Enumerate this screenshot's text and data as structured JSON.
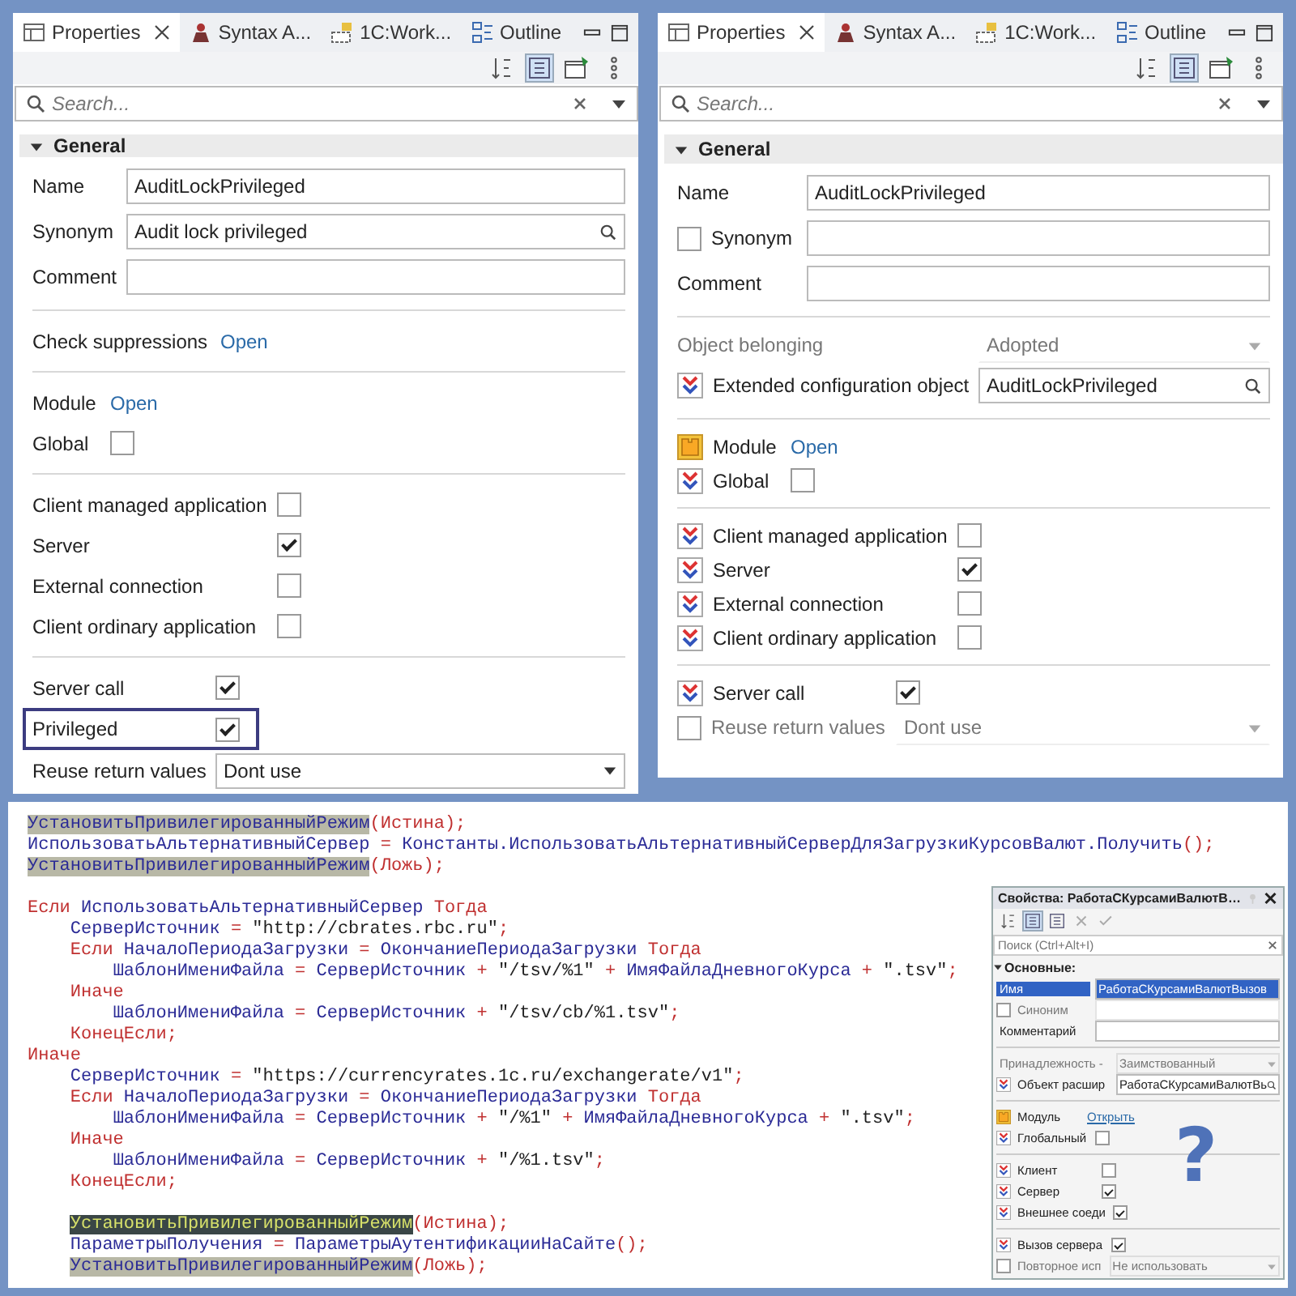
{
  "panels": [
    {
      "tabs": [
        {
          "label": "Properties",
          "kind": "table",
          "selected": true
        },
        {
          "label": "Syntax A...",
          "kind": "figure",
          "selected": false
        },
        {
          "label": "1C:Work...",
          "kind": "blocks",
          "selected": false
        },
        {
          "label": "Outline",
          "kind": "outline",
          "selected": false
        }
      ],
      "toolbar": [
        {
          "kind": "sort",
          "selected": false
        },
        {
          "kind": "tree",
          "selected": true
        },
        {
          "kind": "new-window",
          "selected": false
        },
        {
          "kind": "more",
          "selected": false
        }
      ],
      "search": {
        "placeholder": "Search..."
      },
      "section": {
        "title": "General",
        "expanded": true
      },
      "groups": [
        [
          {
            "kind": "field",
            "label": "Name",
            "value": "AuditLockPrivileged"
          },
          {
            "kind": "search-field",
            "label": "Synonym",
            "value": "Audit lock privileged"
          },
          {
            "kind": "field",
            "label": "Comment"
          }
        ],
        [
          {
            "kind": "link",
            "label": "Check suppressions",
            "link": "Open"
          }
        ],
        [
          {
            "kind": "link",
            "label": "Module",
            "link": "Open"
          },
          {
            "kind": "check",
            "label": "Global",
            "checked": false
          }
        ],
        [
          {
            "kind": "check",
            "label": "Client managed application",
            "checked": false
          },
          {
            "kind": "check",
            "label": "Server",
            "checked": true
          },
          {
            "kind": "check",
            "label": "External connection",
            "checked": false
          },
          {
            "kind": "check",
            "label": "Client ordinary application",
            "checked": false
          }
        ],
        [
          {
            "kind": "check",
            "label": "Server call",
            "checked": true,
            "outlined": false
          },
          {
            "kind": "check",
            "label": "Privileged",
            "checked": true,
            "outlined": true
          },
          {
            "kind": "select",
            "label": "Reuse return values",
            "value": "Dont use",
            "outlined": false
          }
        ]
      ]
    },
    {
      "tabs": [
        {
          "label": "Properties",
          "kind": "table",
          "selected": true
        },
        {
          "label": "Syntax A...",
          "kind": "figure",
          "selected": false
        },
        {
          "label": "1C:Work...",
          "kind": "blocks",
          "selected": false
        },
        {
          "label": "Outline",
          "kind": "outline",
          "selected": false
        }
      ],
      "toolbar": [
        {
          "kind": "sort",
          "selected": false
        },
        {
          "kind": "tree",
          "selected": true
        },
        {
          "kind": "new-window",
          "selected": false
        },
        {
          "kind": "more",
          "selected": false
        }
      ],
      "search": {
        "placeholder": "Search..."
      },
      "section": {
        "title": "General",
        "expanded": true
      },
      "groups": [
        [
          {
            "kind": "field",
            "label": "Name",
            "value": "AuditLockPrivileged"
          },
          {
            "kind": "field",
            "label": "Synonym",
            "adopted": false
          },
          {
            "kind": "field",
            "label": "Comment"
          }
        ],
        [
          {
            "kind": "select",
            "label": "Object belonging",
            "value": "Adopted",
            "disabled": true
          },
          {
            "kind": "search-field",
            "label": "Extended configuration object",
            "value": "AuditLockPrivileged",
            "adopted": true
          }
        ],
        [
          {
            "kind": "module-link",
            "label": "Module",
            "link": "Open"
          },
          {
            "kind": "check",
            "label": "Global",
            "checked": false,
            "adopted": true
          }
        ],
        [
          {
            "kind": "check",
            "label": "Client managed application",
            "checked": false,
            "adopted": true
          },
          {
            "kind": "check",
            "label": "Server",
            "checked": true,
            "adopted": true
          },
          {
            "kind": "check",
            "label": "External connection",
            "checked": false,
            "adopted": true
          },
          {
            "kind": "check",
            "label": "Client ordinary application",
            "checked": false,
            "adopted": true
          }
        ],
        [
          {
            "kind": "check",
            "label": "Server call",
            "checked": true,
            "adopted": true
          },
          {
            "kind": "select",
            "label": "Reuse return values",
            "value": "Dont use",
            "adopted": false,
            "disabled": true
          }
        ]
      ]
    }
  ],
  "code": {
    "blocks": [
      [
        [
          {
            "kind": "hl",
            "text": "УстановитьПривилегированныйРежим"
          },
          {
            "kind": "p",
            "text": "("
          },
          {
            "kind": "kw",
            "text": "Истина"
          },
          {
            "kind": "p",
            "text": ");"
          }
        ],
        [
          {
            "kind": "id",
            "text": "ИспользоватьАльтернативныйСервер "
          },
          {
            "kind": "p",
            "text": "="
          },
          {
            "kind": "id",
            "text": " Константы.ИспользоватьАльтернативныйСерверДляЗагрузкиКурсовВалют.Получить"
          },
          {
            "kind": "p",
            "text": "();"
          }
        ],
        [
          {
            "kind": "hl",
            "text": "УстановитьПривилегированныйРежим"
          },
          {
            "kind": "p",
            "text": "("
          },
          {
            "kind": "kw",
            "text": "Ложь"
          },
          {
            "kind": "p",
            "text": ");"
          }
        ]
      ],
      [
        [
          {
            "kind": "kw",
            "text": "Если "
          },
          {
            "kind": "id",
            "text": "ИспользоватьАльтернативныйСервер "
          },
          {
            "kind": "kw",
            "text": "Тогда"
          }
        ],
        [
          {
            "kind": "id",
            "text": "    СерверИсточник "
          },
          {
            "kind": "p",
            "text": "= "
          },
          {
            "kind": "s",
            "text": "\"http://cbrates.rbc.ru\""
          },
          {
            "kind": "p",
            "text": ";"
          }
        ],
        [
          {
            "kind": "kw",
            "text": "    Если "
          },
          {
            "kind": "id",
            "text": "НачалоПериодаЗагрузки "
          },
          {
            "kind": "p",
            "text": "= "
          },
          {
            "kind": "id",
            "text": "ОкончаниеПериодаЗагрузки "
          },
          {
            "kind": "kw",
            "text": "Тогда"
          }
        ],
        [
          {
            "kind": "id",
            "text": "        ШаблонИмениФайла "
          },
          {
            "kind": "p",
            "text": "= "
          },
          {
            "kind": "id",
            "text": "СерверИсточник "
          },
          {
            "kind": "p",
            "text": "+ "
          },
          {
            "kind": "s",
            "text": "\"/tsv/%1\" "
          },
          {
            "kind": "p",
            "text": "+ "
          },
          {
            "kind": "id",
            "text": "ИмяФайлаДневногоКурса "
          },
          {
            "kind": "p",
            "text": "+ "
          },
          {
            "kind": "s",
            "text": "\".tsv\""
          },
          {
            "kind": "p",
            "text": ";"
          }
        ],
        [
          {
            "kind": "kw",
            "text": "    Иначе"
          }
        ],
        [
          {
            "kind": "id",
            "text": "        ШаблонИмениФайла "
          },
          {
            "kind": "p",
            "text": "= "
          },
          {
            "kind": "id",
            "text": "СерверИсточник "
          },
          {
            "kind": "p",
            "text": "+ "
          },
          {
            "kind": "s",
            "text": "\"/tsv/cb/%1.tsv\""
          },
          {
            "kind": "p",
            "text": ";"
          }
        ],
        [
          {
            "kind": "kw",
            "text": "    КонецЕсли;"
          }
        ],
        [
          {
            "kind": "kw",
            "text": "Иначе"
          }
        ],
        [
          {
            "kind": "id",
            "text": "    СерверИсточник "
          },
          {
            "kind": "p",
            "text": "= "
          },
          {
            "kind": "s",
            "text": "\"https://currencyrates.1c.ru/exchangerate/v1\""
          },
          {
            "kind": "p",
            "text": ";"
          }
        ],
        [
          {
            "kind": "kw",
            "text": "    Если "
          },
          {
            "kind": "id",
            "text": "НачалоПериодаЗагрузки "
          },
          {
            "kind": "p",
            "text": "= "
          },
          {
            "kind": "id",
            "text": "ОкончаниеПериодаЗагрузки "
          },
          {
            "kind": "kw",
            "text": "Тогда"
          }
        ],
        [
          {
            "kind": "id",
            "text": "        ШаблонИмениФайла "
          },
          {
            "kind": "p",
            "text": "= "
          },
          {
            "kind": "id",
            "text": "СерверИсточник "
          },
          {
            "kind": "p",
            "text": "+ "
          },
          {
            "kind": "s",
            "text": "\"/%1\" "
          },
          {
            "kind": "p",
            "text": "+ "
          },
          {
            "kind": "id",
            "text": "ИмяФайлаДневногоКурса "
          },
          {
            "kind": "p",
            "text": "+ "
          },
          {
            "kind": "s",
            "text": "\".tsv\""
          },
          {
            "kind": "p",
            "text": ";"
          }
        ],
        [
          {
            "kind": "kw",
            "text": "    Иначе"
          }
        ],
        [
          {
            "kind": "id",
            "text": "        ШаблонИмениФайла "
          },
          {
            "kind": "p",
            "text": "= "
          },
          {
            "kind": "id",
            "text": "СерверИсточник "
          },
          {
            "kind": "p",
            "text": "+ "
          },
          {
            "kind": "s",
            "text": "\"/%1.tsv\""
          },
          {
            "kind": "p",
            "text": ";"
          }
        ],
        [
          {
            "kind": "kw",
            "text": "    КонецЕсли;"
          }
        ]
      ],
      [
        [
          {
            "kind": "hld",
            "text": "    УстановитьПривилегированныйРежим"
          },
          {
            "kind": "p",
            "text": "("
          },
          {
            "kind": "kw",
            "text": "Истина"
          },
          {
            "kind": "p",
            "text": ");"
          }
        ],
        [
          {
            "kind": "id",
            "text": "    ПараметрыПолучения "
          },
          {
            "kind": "p",
            "text": "= "
          },
          {
            "kind": "id",
            "text": "ПараметрыАутентификацииНаСайте"
          },
          {
            "kind": "p",
            "text": "();"
          }
        ],
        [
          {
            "kind": "hl",
            "text": "    УстановитьПривилегированныйРежим"
          },
          {
            "kind": "p",
            "text": "("
          },
          {
            "kind": "kw",
            "text": "Ложь"
          },
          {
            "kind": "p",
            "text": ");"
          }
        ]
      ]
    ]
  },
  "inset": {
    "title": "Свойства: РаботаСКурсамиВалютВ…",
    "toolbar": [
      {
        "kind": "sort",
        "selected": false
      },
      {
        "kind": "tree",
        "selected": true
      },
      {
        "kind": "tree",
        "selected": false
      },
      {
        "kind": "clear",
        "selected": false
      },
      {
        "kind": "confirm",
        "selected": false
      }
    ],
    "search": {
      "placeholder": "Поиск (Ctrl+Alt+I)"
    },
    "section": {
      "title": "Основные:",
      "expanded": true
    },
    "groups": [
      [
        {
          "kind": "field",
          "label": "Имя",
          "value": "РаботаСКурсамиВалютВызов",
          "selected": true
        },
        {
          "kind": "field",
          "label": "Синоним",
          "adopted": false,
          "disabled": true,
          "selected": false
        },
        {
          "kind": "field",
          "label": "Комментарий",
          "selected": false
        }
      ],
      [
        {
          "kind": "select",
          "label": "Принадлежность -",
          "value": "Заимствованный",
          "disabled": true,
          "selected": false
        },
        {
          "kind": "search-field",
          "label": "Объект расшир",
          "value": "РаботаСКурсамиВалютВь",
          "adopted": true,
          "selected": false
        }
      ],
      [
        {
          "kind": "module-link",
          "label": "Модуль",
          "link": "Открыть",
          "selected": false
        },
        {
          "kind": "check",
          "label": "Глобальный",
          "checked": false,
          "adopted": true,
          "selected": false
        }
      ],
      [
        {
          "kind": "check",
          "label": "Клиент",
          "checked": false,
          "adopted": true,
          "selected": false
        },
        {
          "kind": "check",
          "label": "Сервер",
          "checked": true,
          "adopted": true,
          "selected": false
        },
        {
          "kind": "check",
          "label": "Внешнее соеди",
          "checked": true,
          "adopted": true,
          "selected": false
        }
      ],
      [
        {
          "kind": "check",
          "label": "Вызов сервера",
          "checked": true,
          "adopted": true,
          "selected": false
        },
        {
          "kind": "select",
          "label": "Повторное исп",
          "value": "Не использовать",
          "adopted": false,
          "disabled": true,
          "selected": false
        }
      ]
    ],
    "question_mark": "?"
  }
}
